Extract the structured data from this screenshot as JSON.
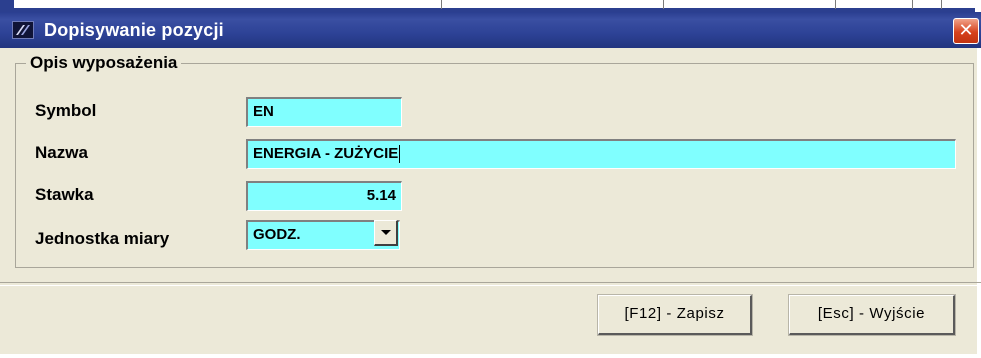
{
  "window": {
    "title": "Dopisywanie pozycji",
    "close_label": "✕"
  },
  "group": {
    "title": "Opis wyposażenia"
  },
  "form": {
    "symbol": {
      "label": "Symbol",
      "value": "EN"
    },
    "nazwa": {
      "label": "Nazwa",
      "value": "ENERGIA - ZUŻYCIE"
    },
    "stawka": {
      "label": "Stawka",
      "value": "5.14"
    },
    "jednostka": {
      "label": "Jednostka miary",
      "value": "GODZ."
    }
  },
  "buttons": {
    "save": "[F12] - Zapisz",
    "exit": "[Esc] - Wyjście"
  },
  "icons": {
    "app": "app-logo-icon",
    "close": "close-icon",
    "dropdown": "chevron-down-icon"
  },
  "colors": {
    "title_bar": "#2d4296",
    "field_background": "#80ffff",
    "dialog_background": "#ece9d8",
    "close_button": "#d6421d"
  }
}
